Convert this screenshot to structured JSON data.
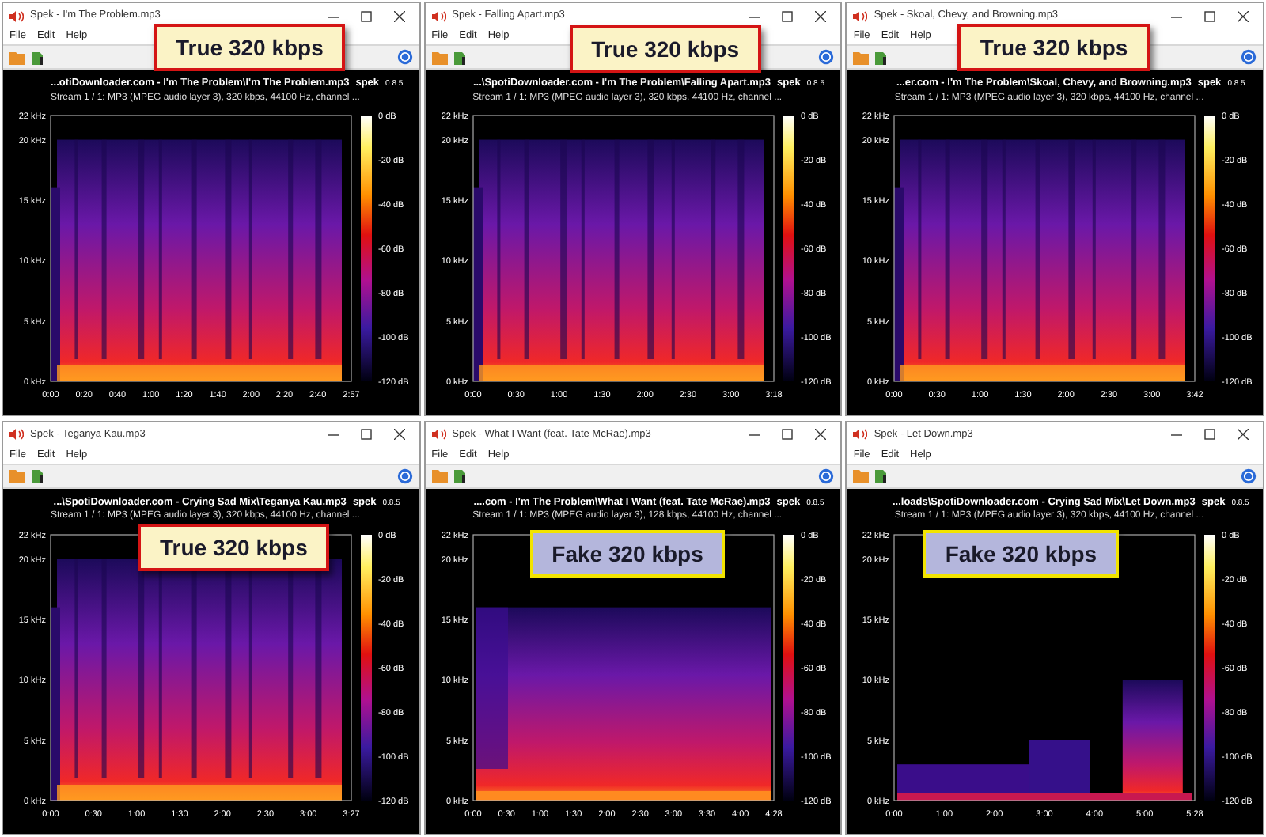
{
  "windows": [
    {
      "title": "Spek - I'm The Problem.mp3",
      "menu": [
        "File",
        "Edit",
        "Help"
      ],
      "header": "...otiDownloader.com - I'm The Problem\\I'm The Problem.mp3",
      "brand": "spek",
      "version": "0.8.5",
      "stream_parts": [
        "Stream 1 / 1: MP3 (MPEG audio layer 3), 320 kbps, 44100 Hz, channel ..."
      ],
      "yticks": [
        "22 kHz",
        "20 kHz",
        "15 kHz",
        "10 kHz",
        "5 kHz",
        "0 kHz"
      ],
      "xticks": [
        "0:00",
        "0:20",
        "0:40",
        "1:00",
        "1:20",
        "1:40",
        "2:00",
        "2:20",
        "2:40",
        "2:57"
      ],
      "db": [
        "0 dB",
        "-20 dB",
        "-40 dB",
        "-60 dB",
        "-80 dB",
        "-100 dB",
        "-120 dB"
      ],
      "verdict": {
        "text": "True 320 kbps",
        "kind": "true"
      }
    },
    {
      "title": "Spek - Falling Apart.mp3",
      "menu": [
        "File",
        "Edit",
        "Help"
      ],
      "header": "...\\SpotiDownloader.com - I'm The Problem\\Falling Apart.mp3",
      "brand": "spek",
      "version": "0.8.5",
      "stream_parts": [
        "Stream 1 / 1: MP3 (MPEG audio layer 3), 320 kbps, 44100 Hz, channel ..."
      ],
      "yticks": [
        "22 kHz",
        "20 kHz",
        "15 kHz",
        "10 kHz",
        "5 kHz",
        "0 kHz"
      ],
      "xticks": [
        "0:00",
        "0:30",
        "1:00",
        "1:30",
        "2:00",
        "2:30",
        "3:00",
        "3:18"
      ],
      "db": [
        "0 dB",
        "-20 dB",
        "-40 dB",
        "-60 dB",
        "-80 dB",
        "-100 dB",
        "-120 dB"
      ],
      "verdict": {
        "text": "True 320 kbps",
        "kind": "true"
      }
    },
    {
      "title": "Spek - Skoal, Chevy, and Browning.mp3",
      "menu": [
        "File",
        "Edit",
        "Help"
      ],
      "header": "...er.com - I'm The Problem\\Skoal, Chevy, and Browning.mp3",
      "brand": "spek",
      "version": "0.8.5",
      "stream_parts": [
        "Stream 1 / 1: MP3 (MPEG audio layer 3), 320 kbps, 44100 Hz, channel ..."
      ],
      "yticks": [
        "22 kHz",
        "20 kHz",
        "15 kHz",
        "10 kHz",
        "5 kHz",
        "0 kHz"
      ],
      "xticks": [
        "0:00",
        "0:30",
        "1:00",
        "1:30",
        "2:00",
        "2:30",
        "3:00",
        "3:42"
      ],
      "db": [
        "0 dB",
        "-20 dB",
        "-40 dB",
        "-60 dB",
        "-80 dB",
        "-100 dB",
        "-120 dB"
      ],
      "verdict": {
        "text": "True 320 kbps",
        "kind": "true"
      }
    },
    {
      "title": "Spek - Teganya Kau.mp3",
      "menu": [
        "File",
        "Edit",
        "Help"
      ],
      "header": "...\\SpotiDownloader.com - Crying Sad Mix\\Teganya Kau.mp3",
      "brand": "spek",
      "version": "0.8.5",
      "stream_parts": [
        "Stream 1 / 1: MP3 (MPEG audio layer 3), 320 kbps, 44100 Hz, channel ..."
      ],
      "yticks": [
        "22 kHz",
        "20 kHz",
        "15 kHz",
        "10 kHz",
        "5 kHz",
        "0 kHz"
      ],
      "xticks": [
        "0:00",
        "0:30",
        "1:00",
        "1:30",
        "2:00",
        "2:30",
        "3:00",
        "3:27"
      ],
      "db": [
        "0 dB",
        "-20 dB",
        "-40 dB",
        "-60 dB",
        "-80 dB",
        "-100 dB",
        "-120 dB"
      ],
      "verdict": {
        "text": "True 320 kbps",
        "kind": "true"
      }
    },
    {
      "title": "Spek - What I Want (feat. Tate McRae).mp3",
      "menu": [
        "File",
        "Edit",
        "Help"
      ],
      "header": "....com - I'm The Problem\\What I Want (feat. Tate McRae).mp3",
      "brand": "spek",
      "version": "0.8.5",
      "stream_parts": [
        "Stream 1 / 1: MP3 (MPEG audio layer 3), 128 kbps, 44100 Hz, channel ..."
      ],
      "yticks": [
        "22 kHz",
        "20 kHz",
        "15 kHz",
        "10 kHz",
        "5 kHz",
        "0 kHz"
      ],
      "xticks": [
        "0:00",
        "0:30",
        "1:00",
        "1:30",
        "2:00",
        "2:30",
        "3:00",
        "3:30",
        "4:00",
        "4:28"
      ],
      "db": [
        "0 dB",
        "-20 dB",
        "-40 dB",
        "-60 dB",
        "-80 dB",
        "-100 dB",
        "-120 dB"
      ],
      "verdict": {
        "text": "Fake 320 kbps",
        "kind": "fake"
      }
    },
    {
      "title": "Spek - Let Down.mp3",
      "menu": [
        "File",
        "Edit",
        "Help"
      ],
      "header": "...loads\\SpotiDownloader.com - Crying Sad Mix\\Let Down.mp3",
      "brand": "spek",
      "version": "0.8.5",
      "stream_parts": [
        "Stream 1 / 1: MP3 (MPEG audio layer 3), 320 kbps, 44100 Hz, channel ..."
      ],
      "yticks": [
        "22 kHz",
        "20 kHz",
        "15 kHz",
        "10 kHz",
        "5 kHz",
        "0 kHz"
      ],
      "xticks": [
        "0:00",
        "1:00",
        "2:00",
        "3:00",
        "4:00",
        "5:00",
        "5:28"
      ],
      "db": [
        "0 dB",
        "-20 dB",
        "-40 dB",
        "-60 dB",
        "-80 dB",
        "-100 dB",
        "-120 dB"
      ],
      "verdict": {
        "text": "Fake 320 kbps",
        "kind": "fake"
      }
    }
  ]
}
